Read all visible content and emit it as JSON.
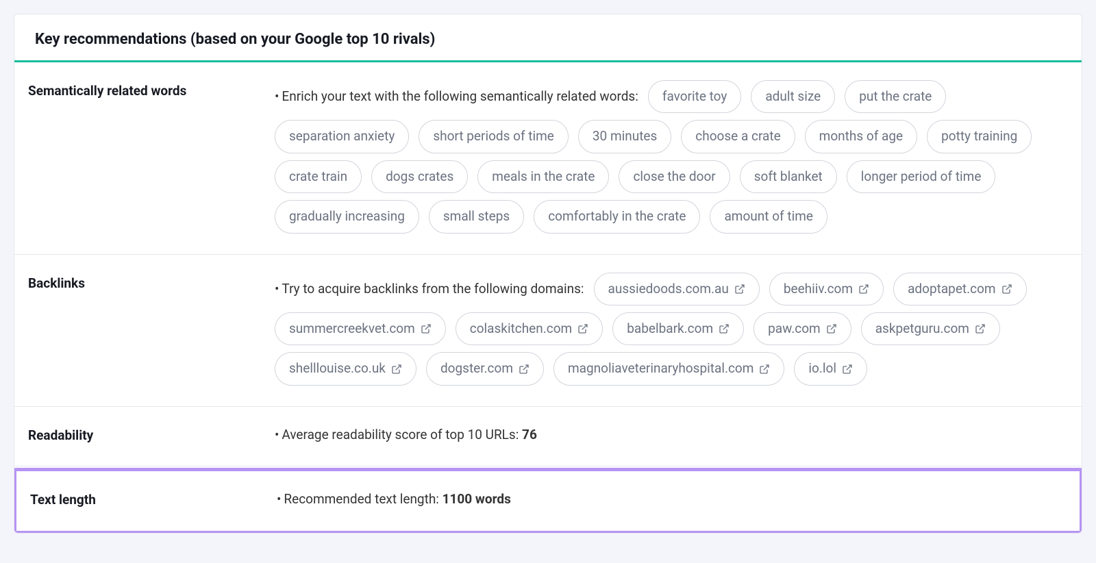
{
  "header": {
    "title": "Key recommendations (based on your Google top 10 rivals)"
  },
  "semantic": {
    "label": "Semantically related words",
    "lead": "Enrich your text with the following semantically related words:",
    "words": [
      "favorite toy",
      "adult size",
      "put the crate",
      "separation anxiety",
      "short periods of time",
      "30 minutes",
      "choose a crate",
      "months of age",
      "potty training",
      "crate train",
      "dogs crates",
      "meals in the crate",
      "close the door",
      "soft blanket",
      "longer period of time",
      "gradually increasing",
      "small steps",
      "comfortably in the crate",
      "amount of time"
    ]
  },
  "backlinks": {
    "label": "Backlinks",
    "lead": "Try to acquire backlinks from the following domains:",
    "domains": [
      "aussiedoods.com.au",
      "beehiiv.com",
      "adoptapet.com",
      "summercreekvet.com",
      "colaskitchen.com",
      "babelbark.com",
      "paw.com",
      "askpetguru.com",
      "shelllouise.co.uk",
      "dogster.com",
      "magnoliaveterinaryhospital.com",
      "io.lol"
    ]
  },
  "readability": {
    "label": "Readability",
    "text_prefix": "Average readability score of top 10 URLs:",
    "value": "76"
  },
  "textlength": {
    "label": "Text length",
    "text_prefix": "Recommended text length:",
    "value": "1100 words"
  }
}
